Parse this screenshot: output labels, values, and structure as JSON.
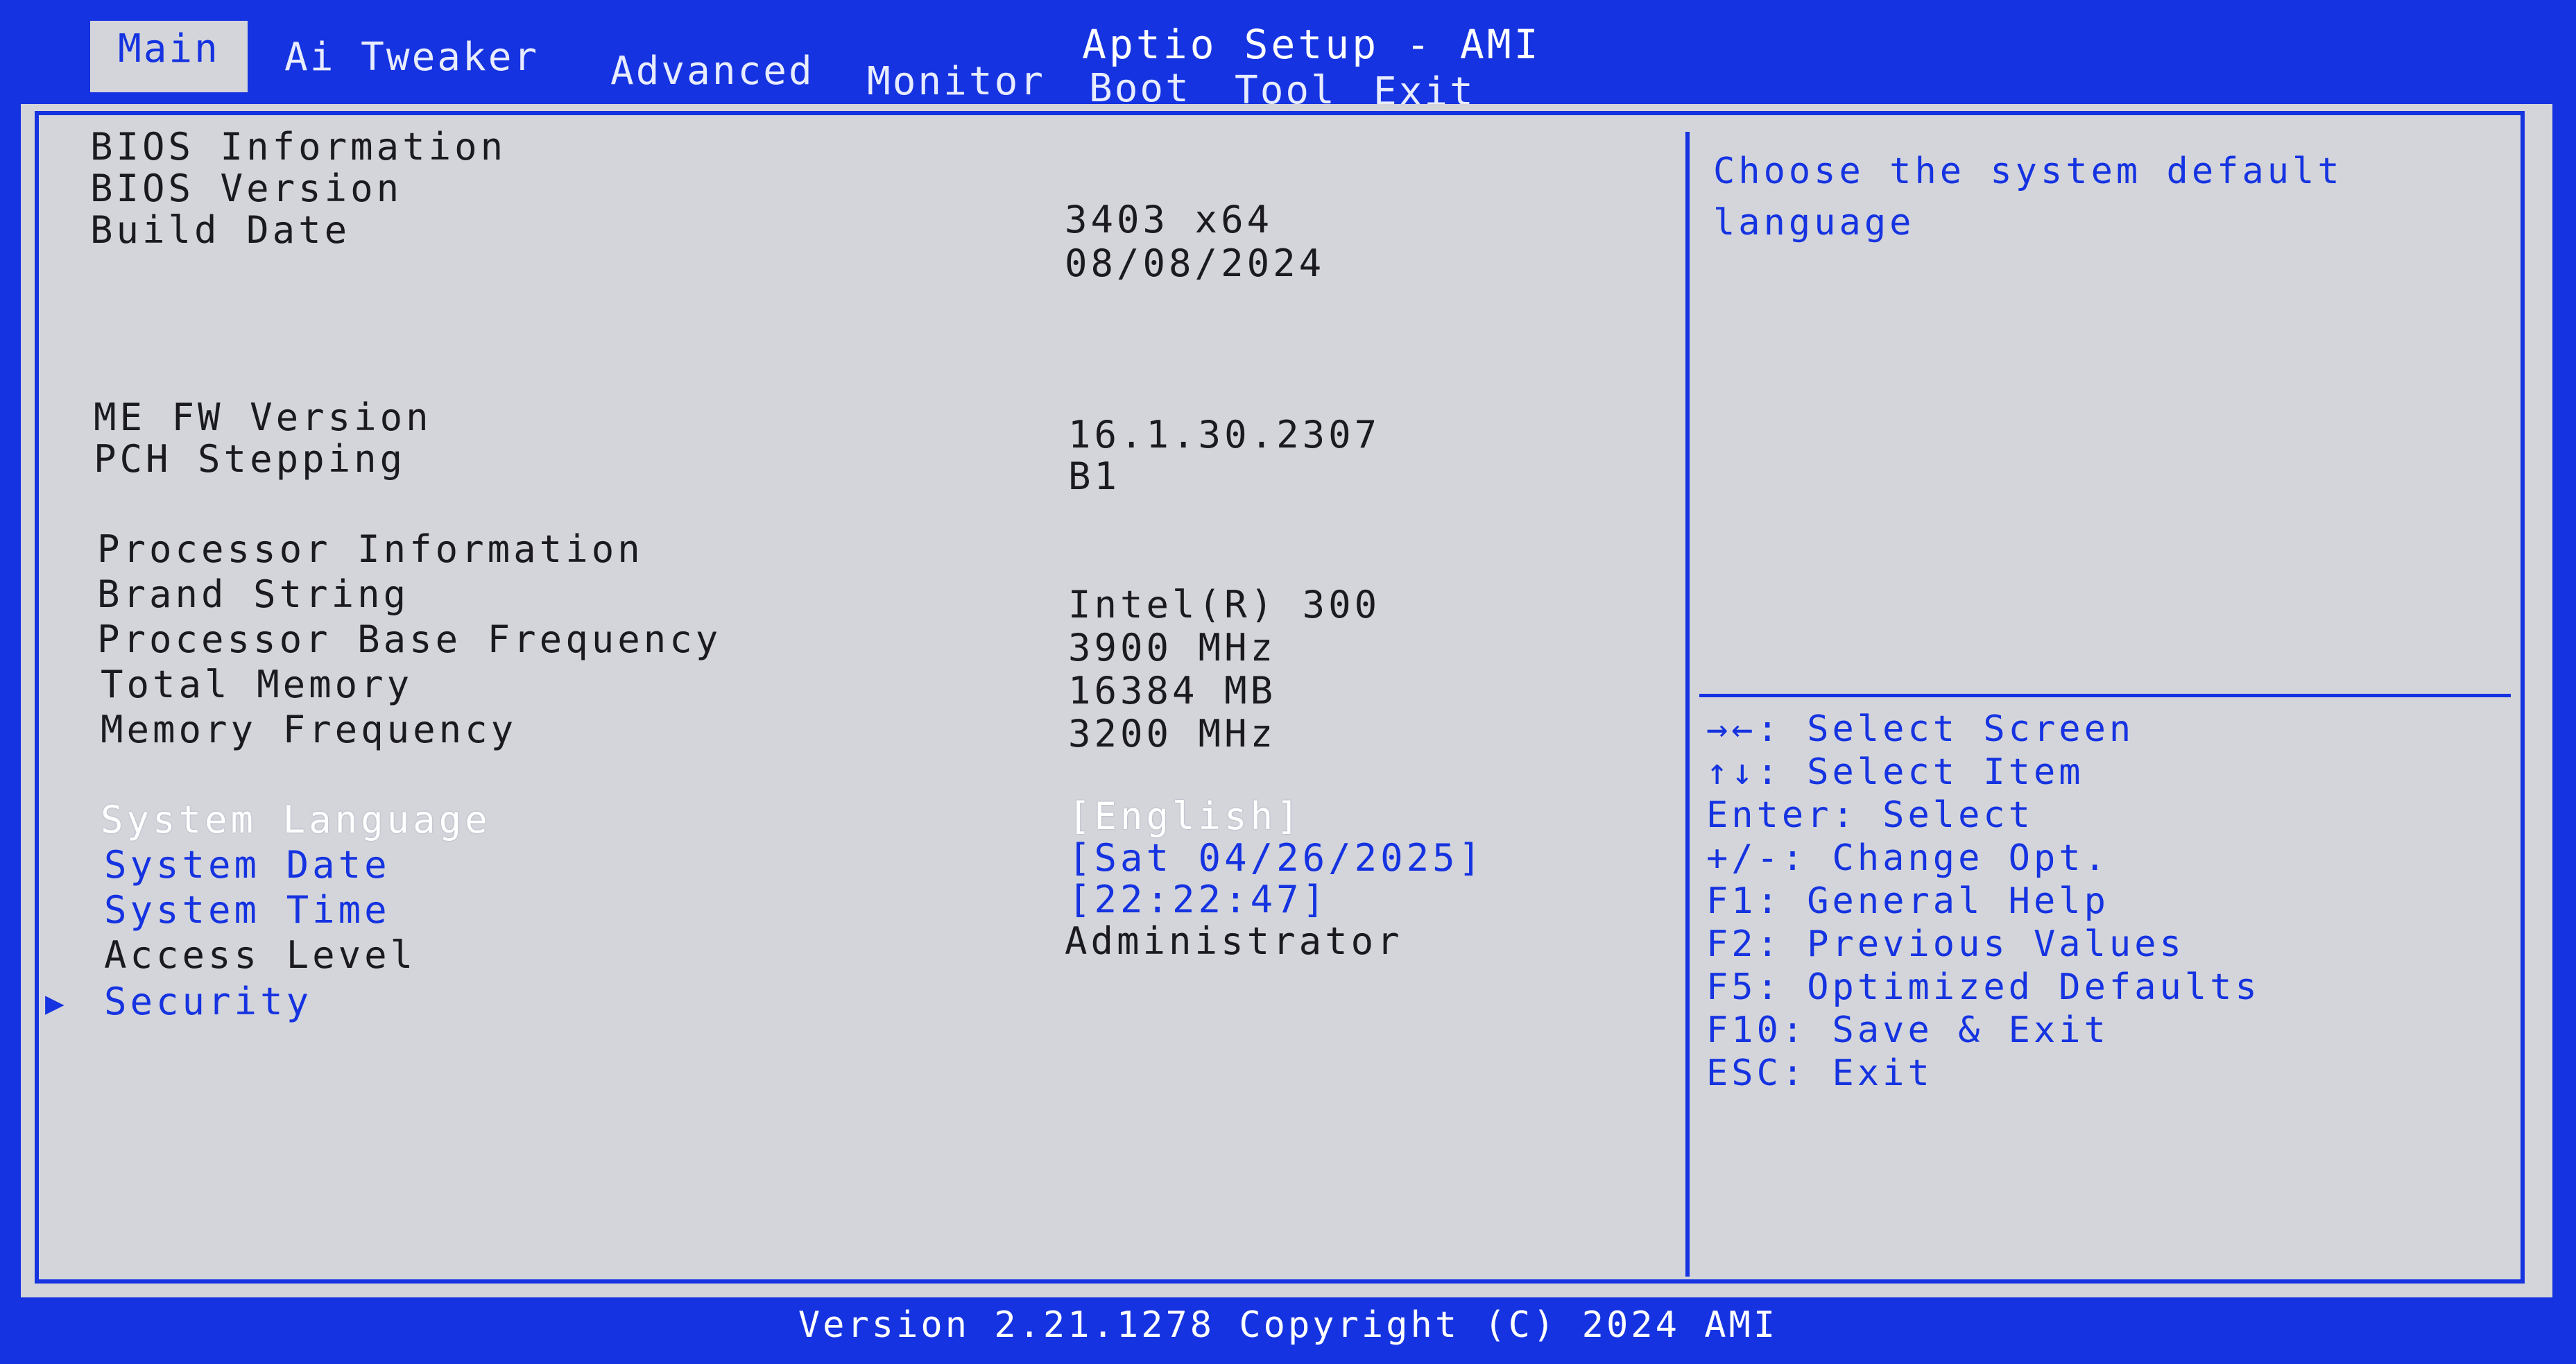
{
  "title": "Aptio Setup - AMI",
  "tabs": [
    "Main",
    "Ai Tweaker",
    "Advanced",
    "Monitor",
    "Boot",
    "Tool",
    "Exit"
  ],
  "main": {
    "bios_info_heading": "BIOS Information",
    "bios_version_label": "BIOS Version",
    "bios_version_value": "3403  x64",
    "build_date_label": "Build Date",
    "build_date_value": "08/08/2024",
    "me_fw_label": "ME FW Version",
    "me_fw_value": "16.1.30.2307",
    "pch_label": "PCH Stepping",
    "pch_value": "B1",
    "proc_info_heading": "Processor Information",
    "brand_label": "Brand String",
    "brand_value": "Intel(R) 300",
    "base_freq_label": "Processor Base Frequency",
    "base_freq_value": "3900 MHz",
    "total_mem_label": "Total Memory",
    "total_mem_value": "16384 MB",
    "mem_freq_label": "Memory Frequency",
    "mem_freq_value": " 3200 MHz",
    "sys_lang_label": "System Language",
    "sys_lang_value": "[English]",
    "sys_date_label": "System Date",
    "sys_date_value": "[Sat 04/26/2025]",
    "sys_time_label": "System Time",
    "sys_time_value": "[22:22:47]",
    "access_label": "Access Level",
    "access_value": "Administrator",
    "security_label": "Security"
  },
  "help": {
    "text": "Choose the system default language"
  },
  "keys": [
    "→←: Select Screen",
    "↑↓: Select Item",
    "Enter: Select",
    "+/-: Change Opt.",
    "F1: General Help",
    "F2: Previous Values",
    "F5: Optimized Defaults",
    "F10: Save & Exit",
    "ESC: Exit"
  ],
  "footer": "Version 2.21.1278 Copyright (C) 2024 AMI",
  "colors": {
    "accent": "#1533e0",
    "panel": "#d4d5da",
    "text": "#1b1b1f",
    "selected": "#ffffff"
  },
  "icons": {
    "submenu": "triangle-right-icon"
  }
}
